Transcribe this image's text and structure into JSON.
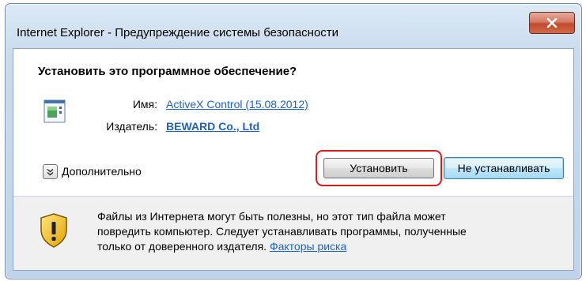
{
  "window": {
    "title": "Internet Explorer - Предупреждение системы безопасности",
    "close_label": "x"
  },
  "dialog": {
    "question": "Установить это программное обеспечение?",
    "name_label": "Имя:",
    "name_value": "ActiveX Control (15.08.2012)",
    "publisher_label": "Издатель:",
    "publisher_value": "BEWARD Co., Ltd",
    "more_options_label": "Дополнительно",
    "install_label": "Установить",
    "dont_install_label": "Не устанавливать"
  },
  "warning": {
    "line1": "Файлы из Интернета могут быть полезны, но этот тип файла может",
    "line2": "повредить компьютер. Следует устанавливать программы, полученные",
    "line3_prefix": "только от доверенного издателя.",
    "risk_link": "Факторы риска"
  },
  "icons": {
    "app": "activex-program-icon",
    "shield": "security-shield-warning-icon",
    "expand": "chevron-down-icon",
    "close": "close-icon"
  },
  "colors": {
    "link": "#1c63c5",
    "highlight": "#d81b1b",
    "close_button": "#c24a2d"
  }
}
